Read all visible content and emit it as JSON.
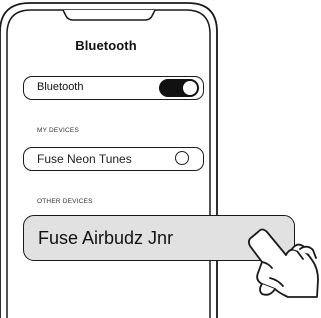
{
  "screen": {
    "title": "Bluetooth"
  },
  "bluetooth_toggle": {
    "label": "Bluetooth",
    "state": "on"
  },
  "my_devices": {
    "heading": "MY DEVICES",
    "items": [
      {
        "name": "Fuse Neon Tunes",
        "selected": false
      }
    ]
  },
  "other_devices": {
    "heading": "OTHER DEVICES",
    "items": [
      {
        "name": "Fuse Airbudz Jnr",
        "highlighted": true
      }
    ]
  },
  "icons": {
    "hand": "pointing-hand-icon",
    "toggle": "toggle-switch-icon",
    "radio": "radio-button-icon"
  },
  "colors": {
    "outline": "#1a1a1a",
    "highlight": "#e1e1e1",
    "toggle_on": "#111111"
  }
}
